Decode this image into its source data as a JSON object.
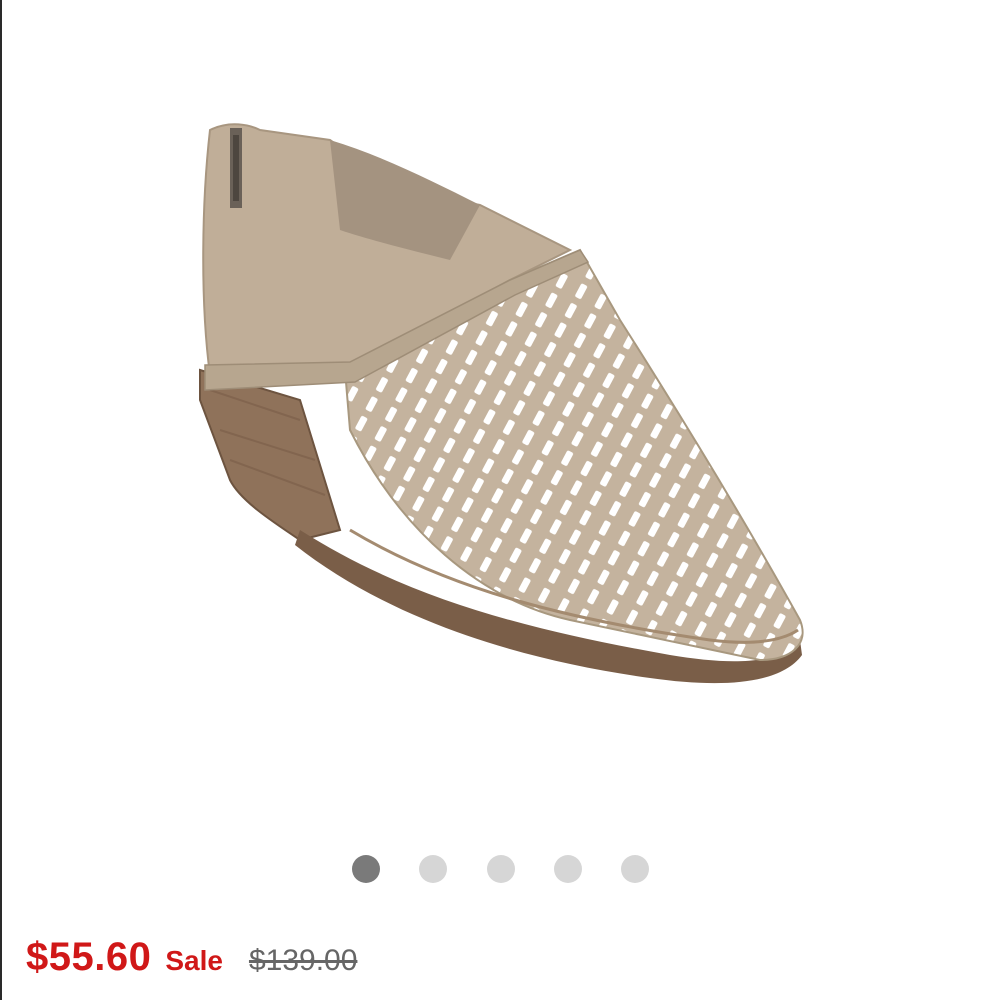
{
  "product": {
    "image_alt": "Perforated suede ankle bootie, taupe",
    "colors": {
      "suede": "#c4b39e",
      "heel": "#8f725a",
      "sole": "#7a5e48"
    }
  },
  "carousel": {
    "count": 5,
    "active_index": 0,
    "active_color": "#7a7a7a",
    "inactive_color": "#d6d6d6"
  },
  "pricing": {
    "sale_price": "$55.60",
    "sale_label": "Sale",
    "original_price": "$139.00",
    "sale_color": "#d01818"
  }
}
